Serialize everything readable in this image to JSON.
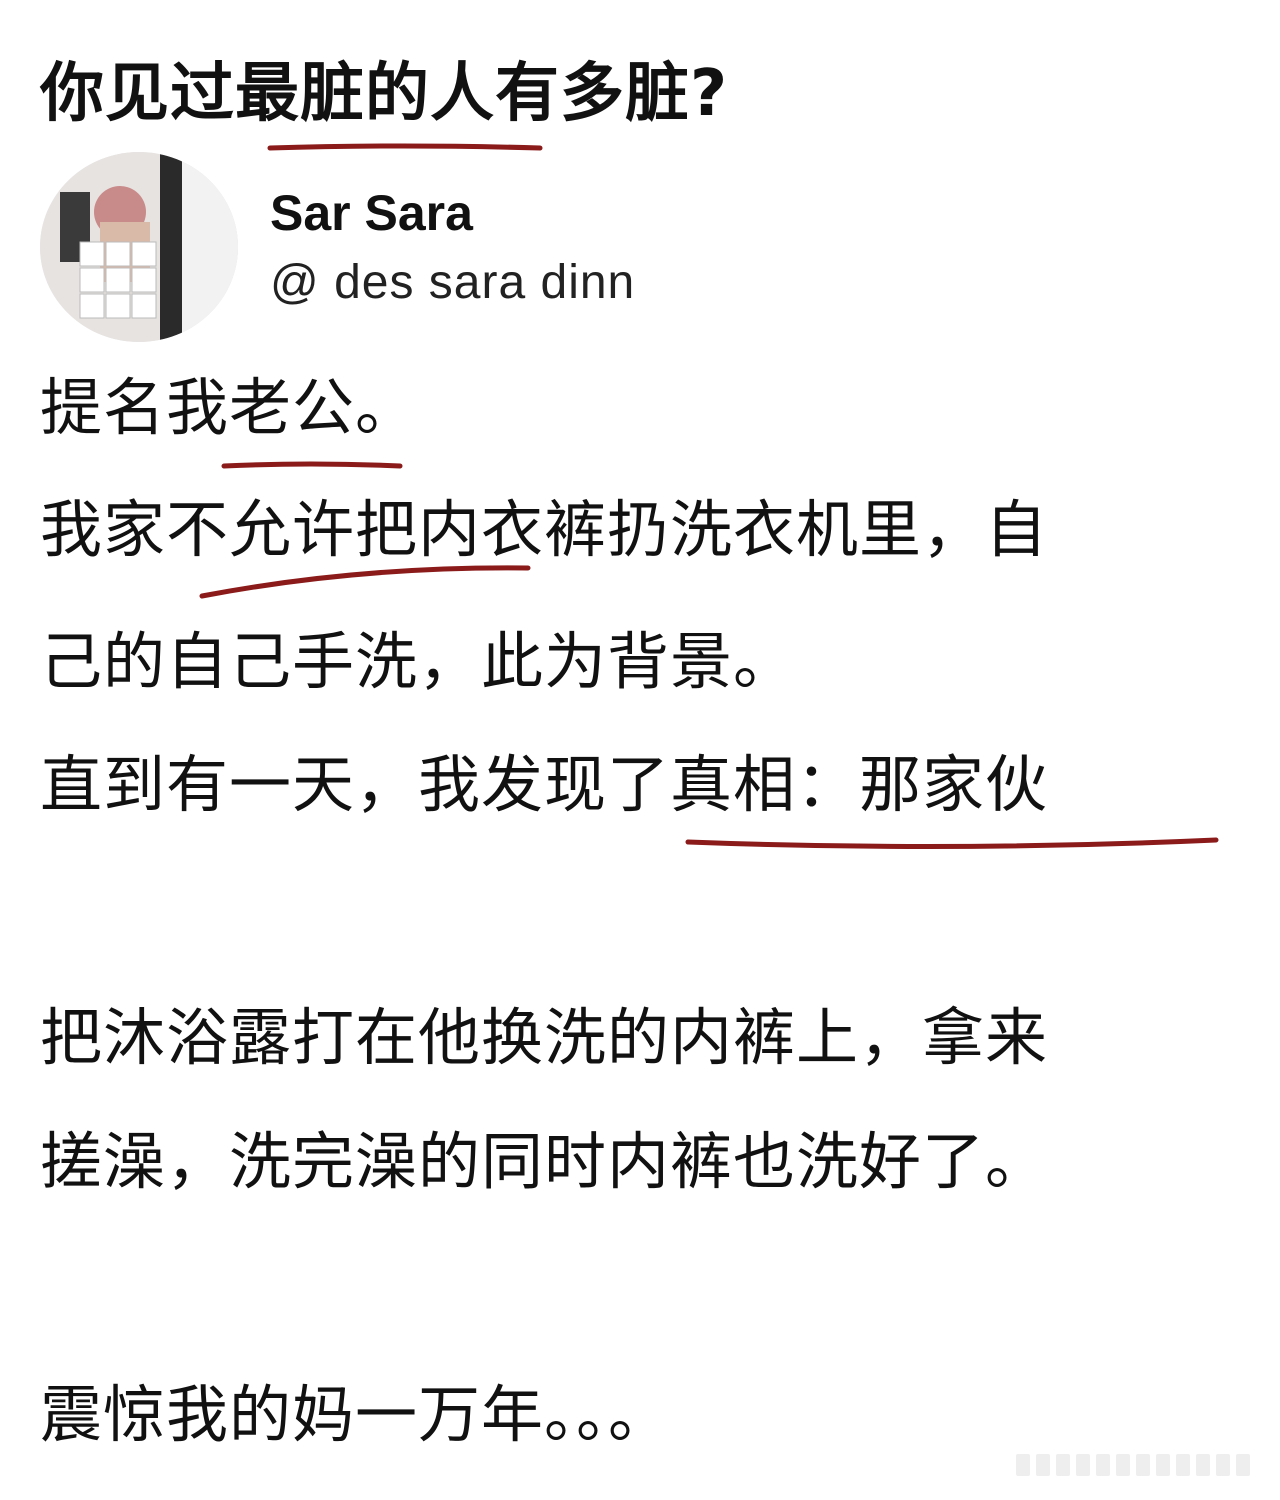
{
  "question": {
    "title": "你见过最脏的人有多脏?"
  },
  "author": {
    "display_name": "Sar Sara",
    "handle": "@ des sara dinn"
  },
  "post": {
    "lines": [
      "提名我老公。",
      "我家不允许把内衣裤扔洗衣机里，自",
      "己的自己手洗，此为背景。",
      "直到有一天，我发现了真相：那家伙",
      "把沐浴露打在他换洗的内裤上，拿来",
      "搓澡，洗完澡的同时内裤也洗好了。",
      "震惊我的妈一万年。。。"
    ]
  },
  "colors": {
    "text": "#111111",
    "underline": "#8b1a1a",
    "background": "#ffffff"
  },
  "icons": {
    "avatar": "profile-avatar-image"
  }
}
